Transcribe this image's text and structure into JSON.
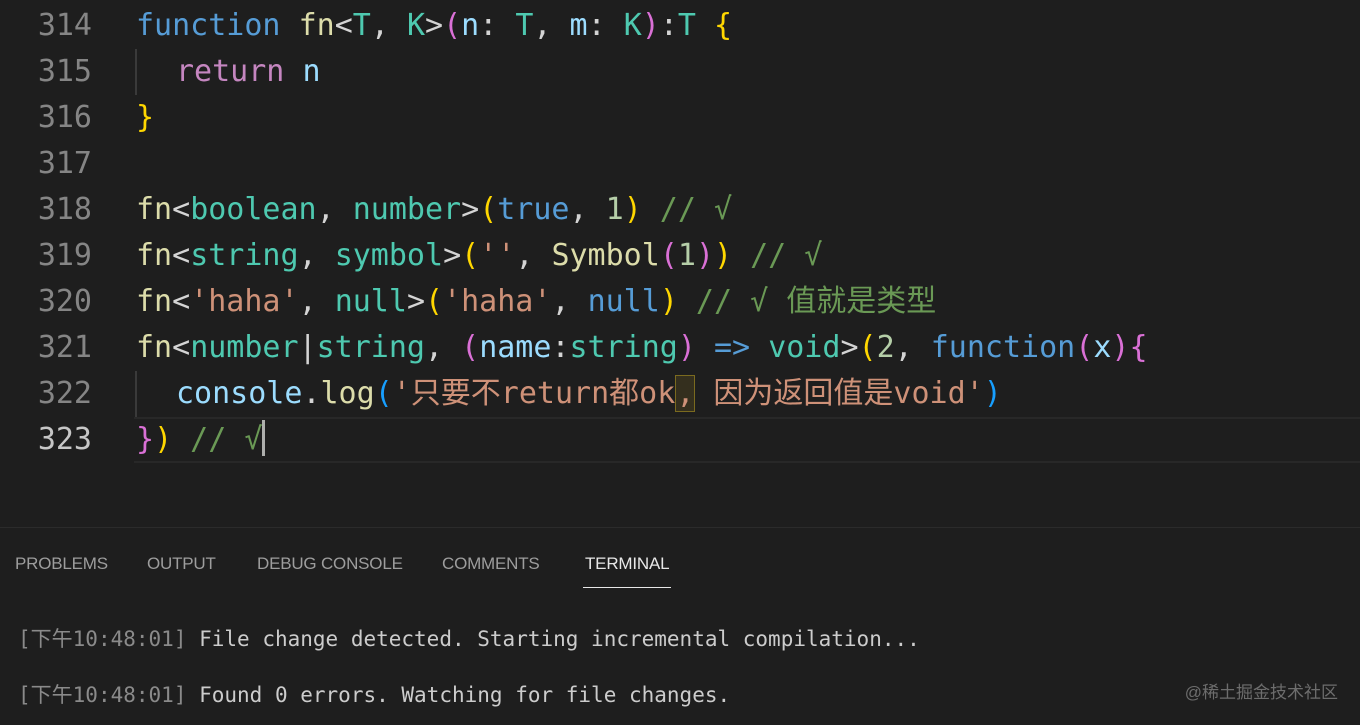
{
  "editor": {
    "line_numbers": [
      "314",
      "315",
      "316",
      "317",
      "318",
      "319",
      "320",
      "321",
      "322",
      "323"
    ],
    "line314": {
      "kw": "function",
      "name": "fn",
      "lt": "<",
      "tp1": "T",
      "comma1": ", ",
      "tp2": "K",
      "gt": ">",
      "lp": "(",
      "p1": "n",
      "c1": ": ",
      "pt1": "T",
      "comma2": ", ",
      "p2": "m",
      "c2": ": ",
      "pt2": "K",
      "rp": ")",
      "colon": ":",
      "ret": "T",
      "brace": "{"
    },
    "line315": {
      "kw": "return",
      "val": "n"
    },
    "line316": {
      "brace": "}"
    },
    "line318": {
      "fn": "fn",
      "lt": "<",
      "t1": "boolean",
      "comma": ", ",
      "t2": "number",
      "gt": ">",
      "lp": "(",
      "a1": "true",
      "comma2": ", ",
      "a2": "1",
      "rp": ")",
      "comment": " // √"
    },
    "line319": {
      "fn": "fn",
      "lt": "<",
      "t1": "string",
      "comma": ", ",
      "t2": "symbol",
      "gt": ">",
      "lp": "(",
      "a1": "''",
      "comma2": ", ",
      "a2": "Symbol",
      "lp2": "(",
      "a3": "1",
      "rp2": ")",
      "rp": ")",
      "comment": " // √"
    },
    "line320": {
      "fn": "fn",
      "lt": "<",
      "t1": "'haha'",
      "comma": ", ",
      "t2": "null",
      "gt": ">",
      "lp": "(",
      "a1": "'haha'",
      "comma2": ", ",
      "a2": "null",
      "rp": ")",
      "comment": " // √ 值就是类型"
    },
    "line321": {
      "fn": "fn",
      "lt": "<",
      "t1": "number",
      "bar": "|",
      "t2": "string",
      "comma": ", ",
      "lp": "(",
      "pname": "name",
      "colon": ":",
      "ptype": "string",
      "rp": ")",
      "arrow": " => ",
      "ret": "void",
      "gt": ">",
      "lp2": "(",
      "a1": "2",
      "comma2": ", ",
      "kw": "function",
      "lp3": "(",
      "x": "x",
      "rp3": ")",
      "brace": "{"
    },
    "line322": {
      "obj": "console",
      "dot": ".",
      "method": "log",
      "lp": "(",
      "s1": "'只要不return都ok",
      "sel": ",",
      "s2": " 因为返回值是void'",
      "rp": ")"
    },
    "line323": {
      "brace": "}",
      "rp": ")",
      "comment": " // √"
    }
  },
  "panel": {
    "tabs": [
      "PROBLEMS",
      "OUTPUT",
      "DEBUG CONSOLE",
      "COMMENTS",
      "TERMINAL"
    ],
    "active_tab": "TERMINAL",
    "terminal": [
      {
        "prefix": "[下午",
        "time": "10:48:01",
        "suffix": "]",
        "message": " File change detected. Starting incremental compilation..."
      },
      {
        "prefix": "[下午",
        "time": "10:48:01",
        "suffix": "]",
        "message": " Found 0 errors. Watching for file changes."
      }
    ]
  },
  "watermark": "@稀土掘金技术社区"
}
